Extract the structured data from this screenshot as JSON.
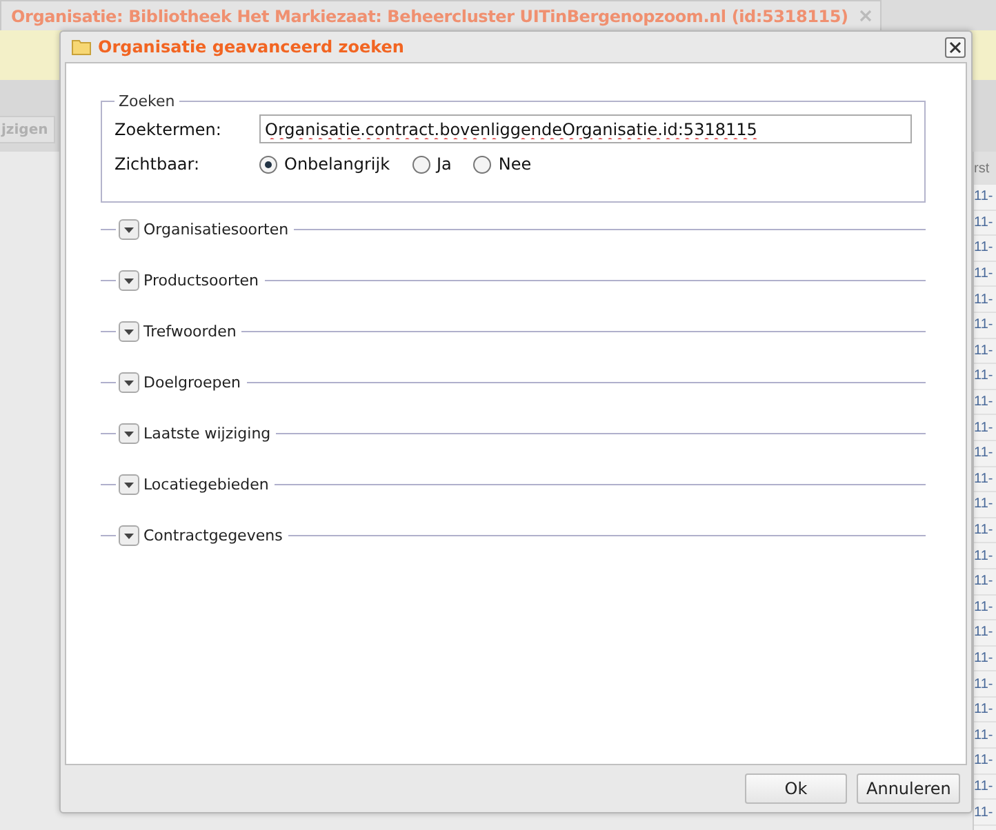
{
  "background_tab": {
    "title": "Organisatie: Bibliotheek Het Markiezaat: Beheercluster UITinBergenopzoom.nl (id:5318115)"
  },
  "toolbar": {
    "button": "jzigen"
  },
  "grid": {
    "column_header": "rst",
    "cells": [
      "11-",
      "11-",
      "11-",
      "11-",
      "11-",
      "11-",
      "11-",
      "11-",
      "11-",
      "11-",
      "11-",
      "11-",
      "11-",
      "11-",
      "11-",
      "11-",
      "11-",
      "11-",
      "11-",
      "11-",
      "11-",
      "11-",
      "11-",
      "11-",
      "11-"
    ]
  },
  "dialog": {
    "title": "Organisatie geavanceerd zoeken",
    "fieldset": {
      "legend": "Zoeken",
      "search_label": "Zoektermen:",
      "search_value": "Organisatie.contract.bovenliggendeOrganisatie.id:5318115",
      "visibility_label": "Zichtbaar:",
      "options": [
        {
          "label": "Onbelangrijk",
          "selected": true
        },
        {
          "label": "Ja",
          "selected": false
        },
        {
          "label": "Nee",
          "selected": false
        }
      ]
    },
    "sections": [
      {
        "label": "Organisatiesoorten",
        "expanded": false
      },
      {
        "label": "Productsoorten",
        "expanded": false
      },
      {
        "label": "Trefwoorden",
        "expanded": false
      },
      {
        "label": "Doelgroepen",
        "expanded": false
      },
      {
        "label": "Laatste wijziging",
        "expanded": false
      },
      {
        "label": "Locatiegebieden",
        "expanded": false
      },
      {
        "label": "Contractgegevens",
        "expanded": false
      }
    ],
    "buttons": [
      "Ok",
      "Annuleren"
    ]
  }
}
